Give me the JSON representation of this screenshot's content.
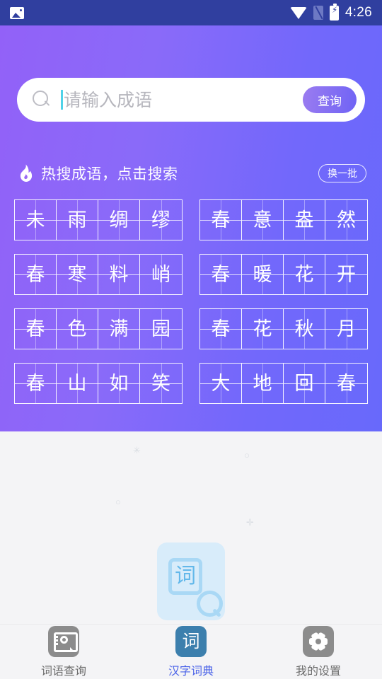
{
  "status_bar": {
    "time": "4:26",
    "icons": {
      "left": "image-icon",
      "wifi": "wifi-icon",
      "sim": "sim-card-disabled-icon",
      "battery": "battery-charging-icon"
    },
    "background_color": "#303f9f"
  },
  "hero": {
    "gradient_start": "#9261f8",
    "gradient_end": "#6869fb"
  },
  "search": {
    "placeholder": "请输入成语",
    "value": "",
    "button_label": "查询",
    "search_icon": "search-icon",
    "caret_color": "#4fd2e8",
    "button_gradient_start": "#9b7cf0",
    "button_gradient_end": "#6f63f5"
  },
  "hot_section": {
    "icon": "fire-icon",
    "title": "热搜成语，点击搜索",
    "refresh_label": "换一批",
    "idioms": [
      {
        "text": "未雨绸缪",
        "chars": [
          "未",
          "雨",
          "绸",
          "缪"
        ]
      },
      {
        "text": "春意盎然",
        "chars": [
          "春",
          "意",
          "盎",
          "然"
        ]
      },
      {
        "text": "春寒料峭",
        "chars": [
          "春",
          "寒",
          "料",
          "峭"
        ]
      },
      {
        "text": "春暖花开",
        "chars": [
          "春",
          "暖",
          "花",
          "开"
        ]
      },
      {
        "text": "春色满园",
        "chars": [
          "春",
          "色",
          "满",
          "园"
        ]
      },
      {
        "text": "春花秋月",
        "chars": [
          "春",
          "花",
          "秋",
          "月"
        ]
      },
      {
        "text": "春山如笑",
        "chars": [
          "春",
          "山",
          "如",
          "笑"
        ]
      },
      {
        "text": "大地回春",
        "chars": [
          "大",
          "地",
          "回",
          "春"
        ]
      }
    ]
  },
  "watermark": {
    "char": "词",
    "icon": "dictionary-search-watermark",
    "sparkles": [
      "✳",
      "○",
      "○",
      "✛"
    ]
  },
  "tabbar": {
    "tabs": [
      {
        "label": "词语查询",
        "icon": "word-lookup-icon",
        "active": false
      },
      {
        "label": "汉字词典",
        "icon": "dictionary-icon",
        "icon_char": "词",
        "active": true
      },
      {
        "label": "我的设置",
        "icon": "gear-icon",
        "active": false
      }
    ],
    "active_color": "#4a62e8",
    "inactive_color": "#6b6b6b",
    "active_icon_color": "#3c7fad",
    "inactive_icon_color": "#8c8c8c"
  }
}
